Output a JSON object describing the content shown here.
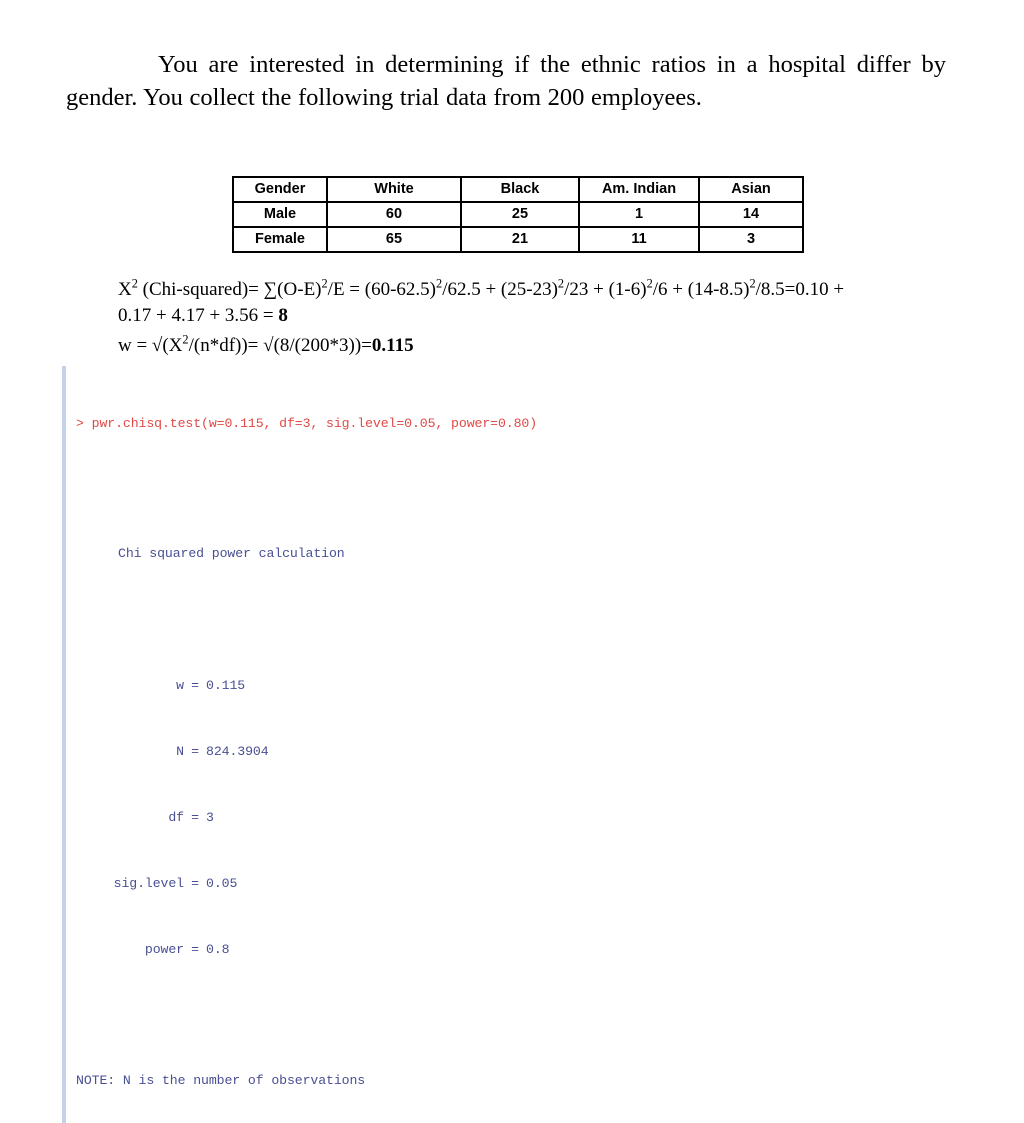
{
  "slide": {
    "intro_paragraph": "You are interested in determining if the ethnic ratios in a hospital differ by gender. You collect the following  trial data from 200 employees."
  },
  "data_table": {
    "headers": [
      "Gender",
      "White",
      "Black",
      "Am. Indian",
      "Asian"
    ],
    "rows": [
      {
        "gender": "Male",
        "white": "60",
        "black": "25",
        "am_indian": "1",
        "asian": "14"
      },
      {
        "gender": "Female",
        "white": "65",
        "black": "21",
        "am_indian": "11",
        "asian": "3"
      }
    ]
  },
  "math": {
    "line1_a": "X",
    "line1_sup1": "2",
    "line1_b": " (Chi-squared)= ∑(O-E)",
    "line1_sup2": "2",
    "line1_c": "/E = (60-62.5)",
    "line1_sup3": "2",
    "line1_d": "/62.5 + (25-23)",
    "line1_sup4": "2",
    "line1_e": "/23 + (1-6)",
    "line1_sup5": "2",
    "line1_f": "/6 + (14-8.5)",
    "line1_sup6": "2",
    "line1_g": "/8.5=0.10 +",
    "line2_a": "0.17 + 4.17 + 3.56 = ",
    "line2_result": "8",
    "line3_a": "w = √(X",
    "line3_sup1": "2",
    "line3_b": "/(n*df))= √(8/(200*3))=",
    "line3_result": "0.115"
  },
  "console": {
    "command": "> pwr.chisq.test(w=0.115, df=3, sig.level=0.05, power=0.80)",
    "output_title": "Chi squared power calculation",
    "results": [
      {
        "label": "w",
        "eq": "=",
        "value": "0.115"
      },
      {
        "label": "N",
        "eq": "=",
        "value": "824.3904"
      },
      {
        "label": "df",
        "eq": "=",
        "value": "3"
      },
      {
        "label": "sig.level",
        "eq": "=",
        "value": "0.05"
      },
      {
        "label": "power",
        "eq": "=",
        "value": "0.8"
      }
    ],
    "note": "NOTE: N is the number of observations",
    "command_color": "#e04a46",
    "output_color": "#494f93",
    "gutter_color": "#c3d2e6"
  }
}
